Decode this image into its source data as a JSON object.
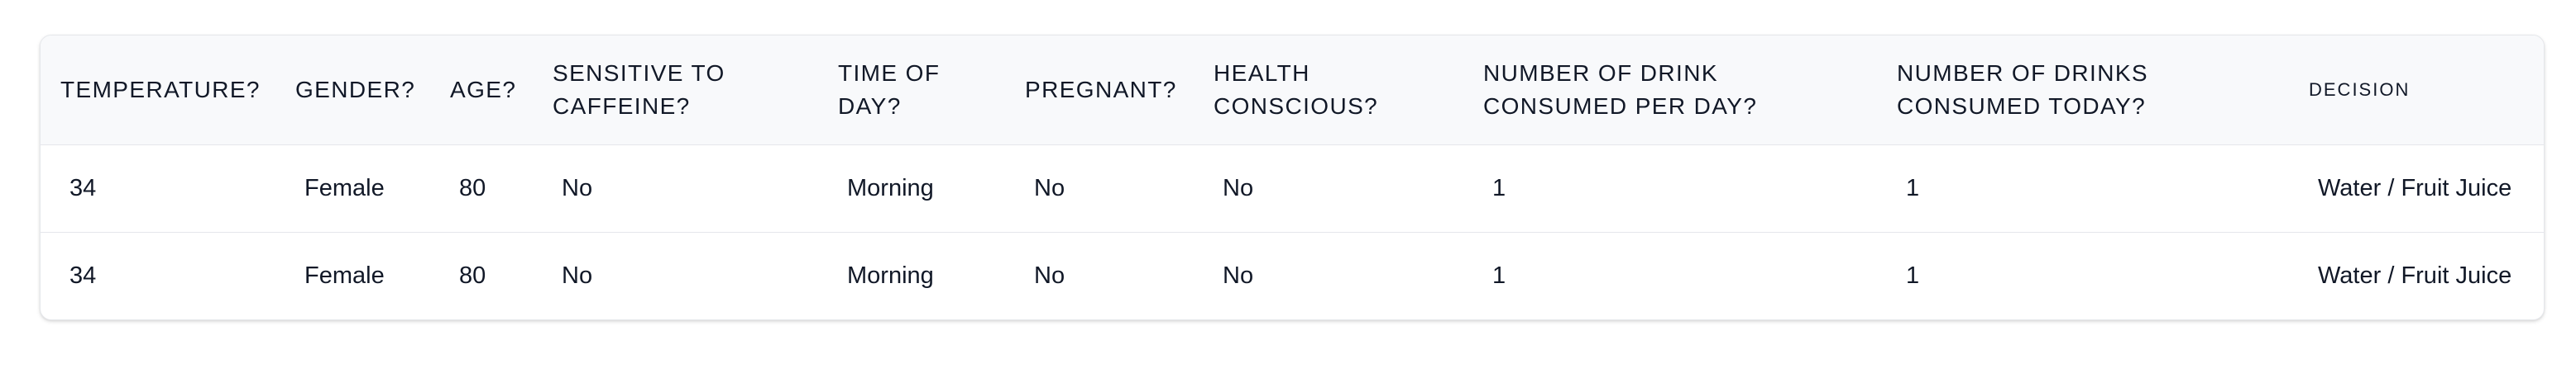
{
  "table": {
    "headers": [
      "TEMPERATURE?",
      "GENDER?",
      "AGE?",
      "SENSITIVE TO CAFFEINE?",
      "TIME OF DAY?",
      "PREGNANT?",
      "HEALTH CONSCIOUS?",
      "NUMBER OF DRINK CONSUMED PER DAY?",
      "NUMBER OF DRINKS CONSUMED TODAY?",
      "DECISION"
    ],
    "rows": [
      [
        "34",
        "Female",
        "80",
        "No",
        "Morning",
        "No",
        "No",
        "1",
        "1",
        "Water / Fruit Juice"
      ],
      [
        "34",
        "Female",
        "80",
        "No",
        "Morning",
        "No",
        "No",
        "1",
        "1",
        "Water / Fruit Juice"
      ]
    ]
  }
}
